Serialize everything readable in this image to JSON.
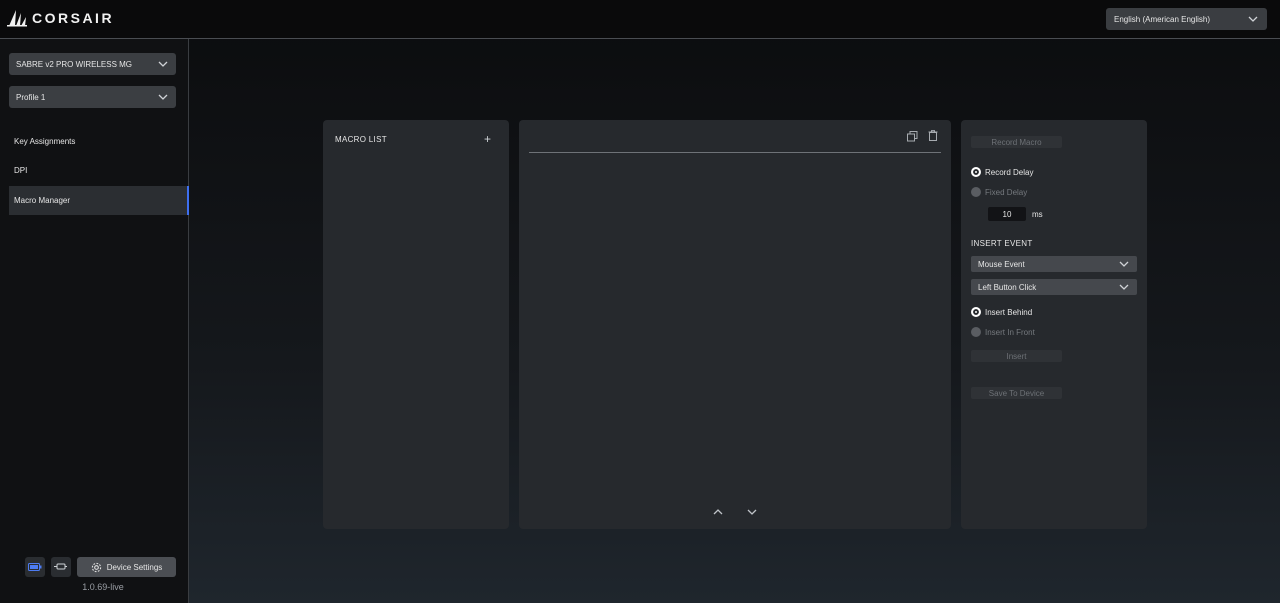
{
  "header": {
    "logo_text": "CORSAIR",
    "language": "English (American English)"
  },
  "sidebar": {
    "device": "SABRE v2 PRO WIRELESS MG",
    "profile": "Profile 1",
    "items": [
      {
        "label": "Key Assignments"
      },
      {
        "label": "DPI"
      },
      {
        "label": "Macro Manager"
      }
    ],
    "device_settings_label": "Device Settings",
    "version": "1.0.69-live"
  },
  "macro_list": {
    "title": "MACRO LIST"
  },
  "controls": {
    "record_macro": "Record Macro",
    "record_delay": "Record Delay",
    "fixed_delay": "Fixed Delay",
    "delay_value": "10",
    "delay_unit": "ms",
    "insert_event_title": "INSERT EVENT",
    "event_type": "Mouse Event",
    "event_action": "Left Button Click",
    "insert_behind": "Insert Behind",
    "insert_in_front": "Insert In Front",
    "insert": "Insert",
    "save_to_device": "Save To Device"
  },
  "colors": {
    "accent": "#3e6ff0",
    "panel": "#26292d"
  }
}
